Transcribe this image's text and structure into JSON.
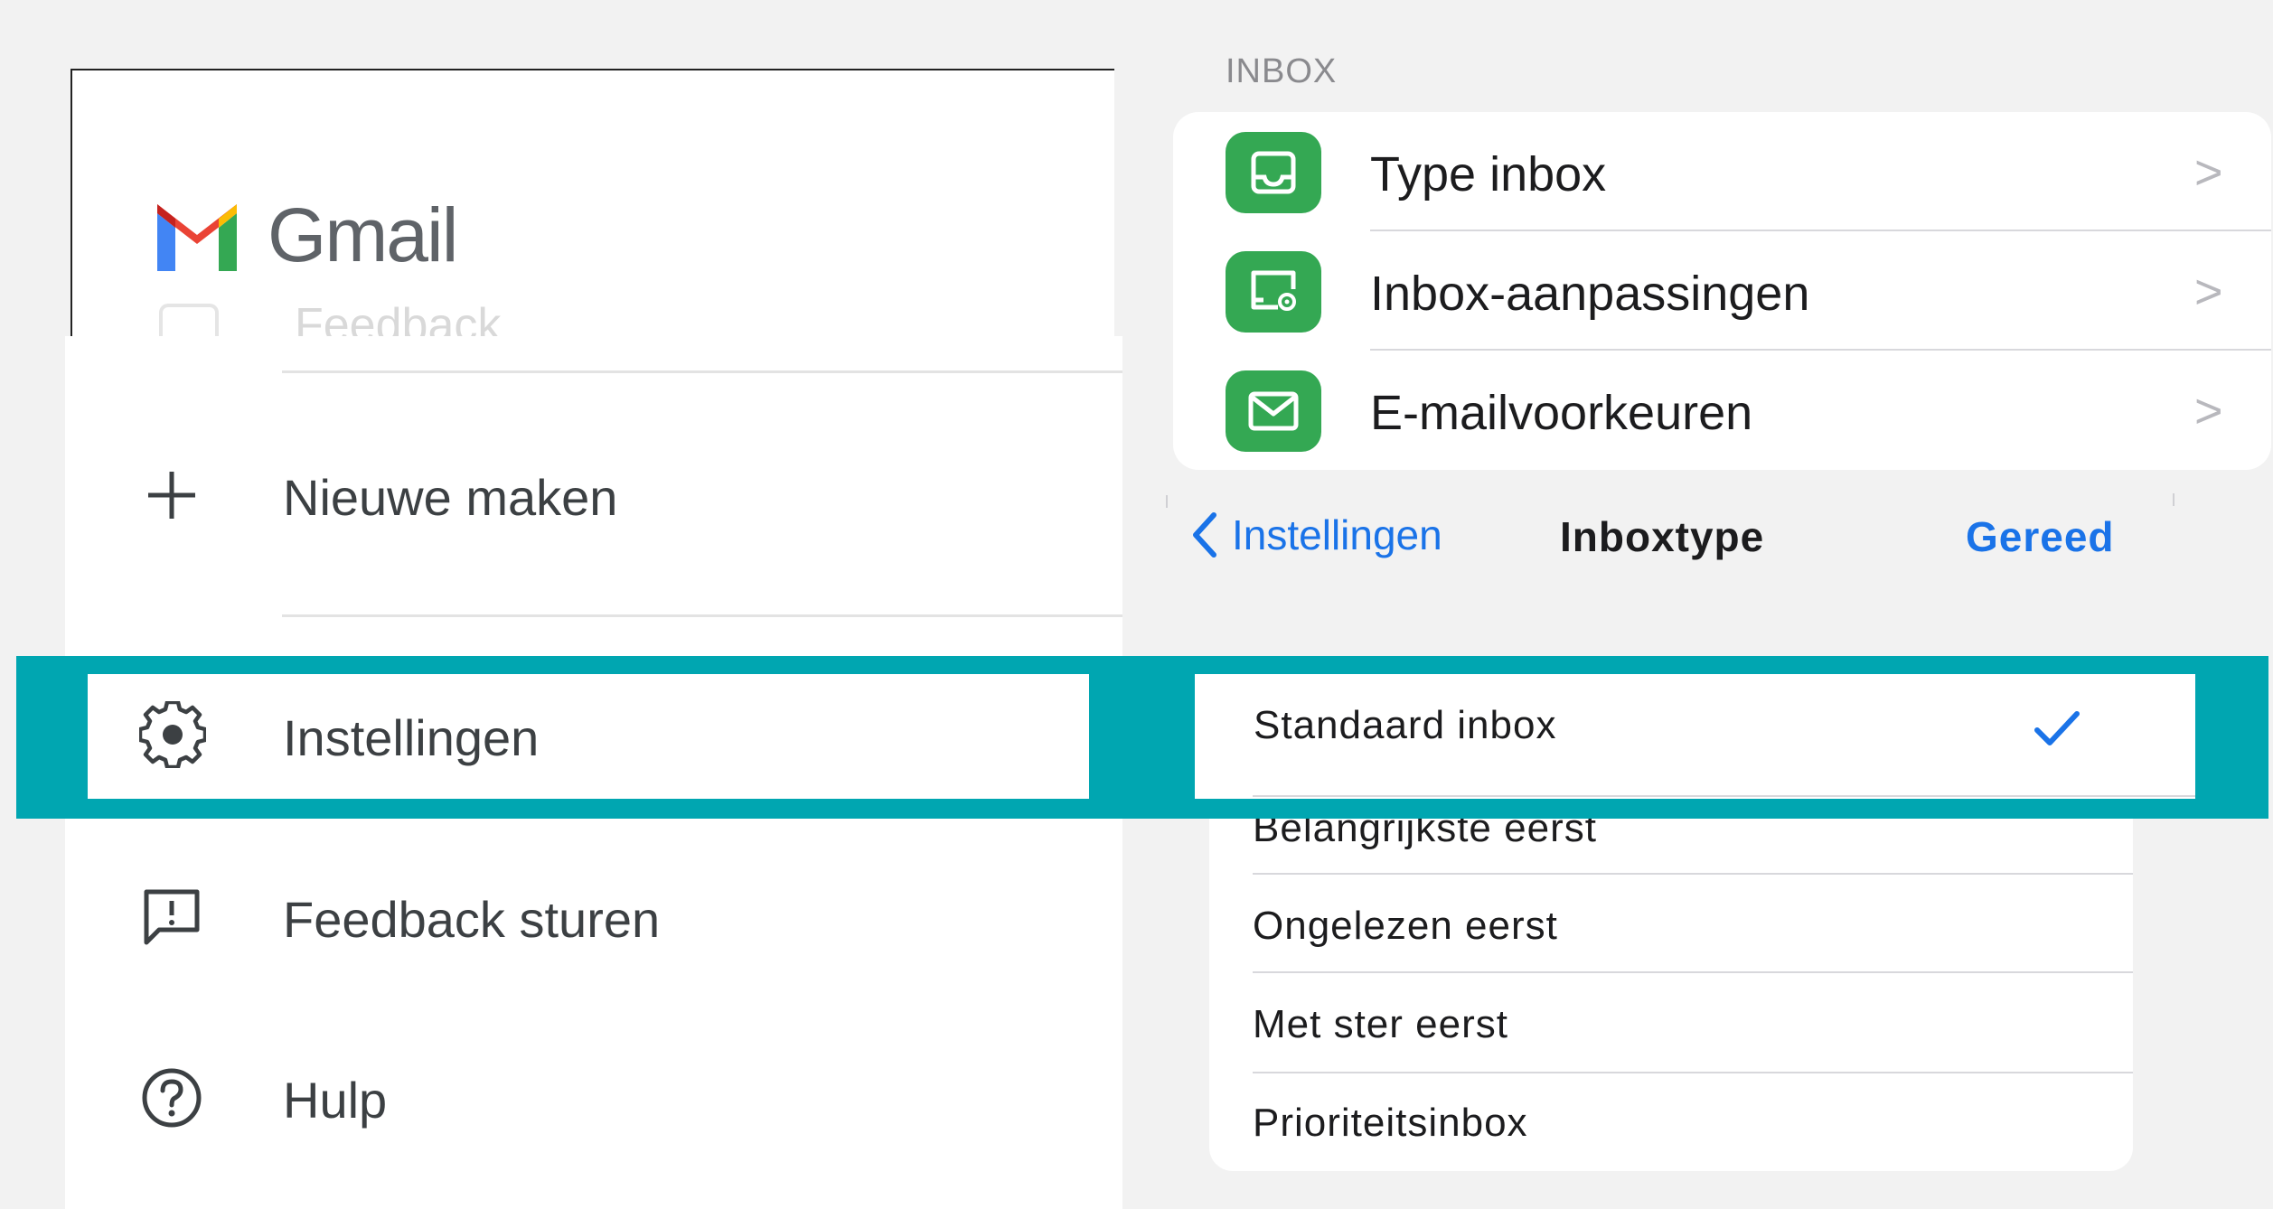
{
  "gmail": {
    "brand": "Gmail",
    "ghost_item": "Feedback",
    "menu": [
      {
        "label": "Nieuwe maken",
        "icon": "plus-icon"
      },
      {
        "label": "Instellingen",
        "icon": "gear-icon"
      },
      {
        "label": "Feedback sturen",
        "icon": "feedback-icon"
      },
      {
        "label": "Hulp",
        "icon": "help-icon"
      }
    ]
  },
  "settings": {
    "section_header": "INBOX",
    "rows": [
      {
        "label": "Type inbox",
        "icon": "inbox-tray-icon"
      },
      {
        "label": "Inbox-aanpassingen",
        "icon": "inbox-settings-icon"
      },
      {
        "label": "E-mailvoorkeuren",
        "icon": "mail-envelope-icon"
      }
    ]
  },
  "inbox_type": {
    "back_label": "Instellingen",
    "title": "Inboxtype",
    "done_label": "Gereed",
    "options": [
      {
        "label": "Standaard inbox",
        "selected": true
      },
      {
        "label": "Belangrijkste eerst",
        "selected": false
      },
      {
        "label": "Ongelezen eerst",
        "selected": false
      },
      {
        "label": "Met ster eerst",
        "selected": false
      },
      {
        "label": "Prioriteitsinbox",
        "selected": false
      }
    ]
  },
  "colors": {
    "highlight": "#00a6b1",
    "ios_green": "#34a853",
    "ios_blue": "#1a73e8"
  }
}
